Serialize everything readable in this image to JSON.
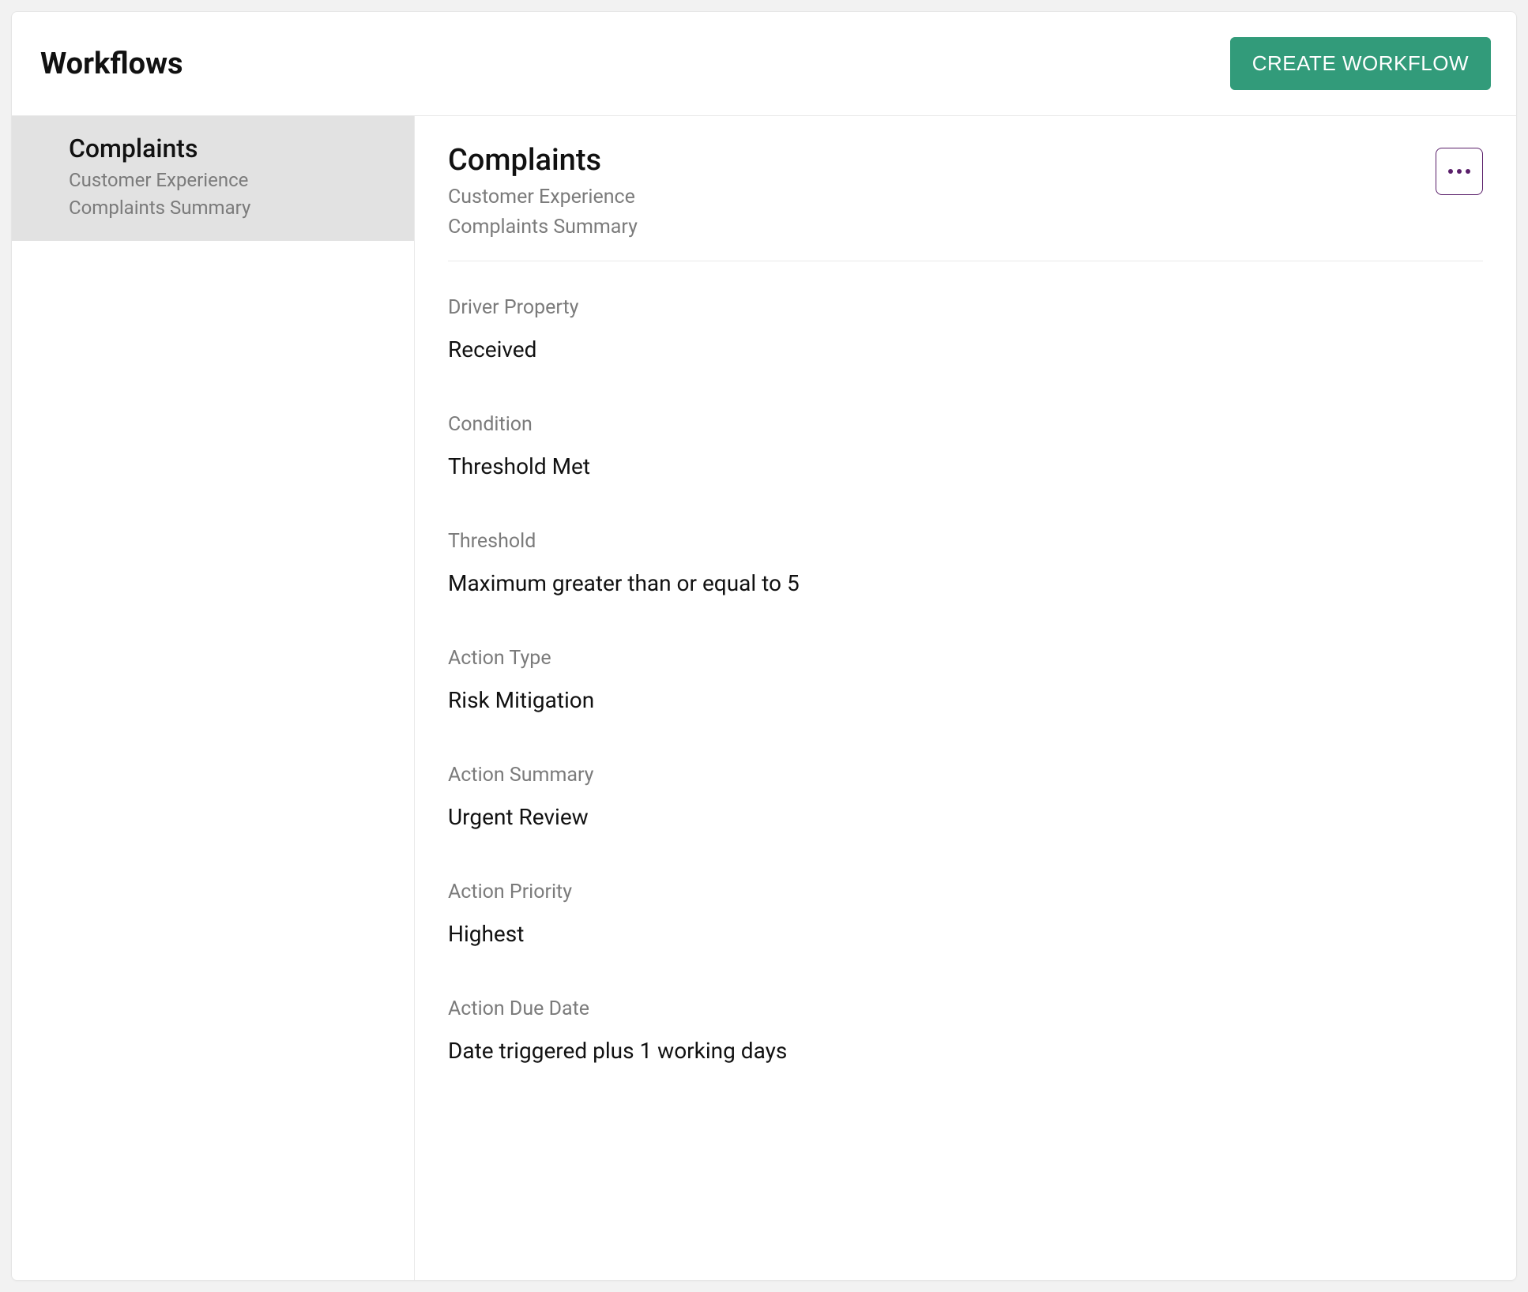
{
  "header": {
    "title": "Workflows",
    "create_button_label": "CREATE WORKFLOW"
  },
  "sidebar": {
    "items": [
      {
        "title": "Complaints",
        "subtitle1": "Customer Experience",
        "subtitle2": "Complaints Summary"
      }
    ]
  },
  "detail": {
    "title": "Complaints",
    "subtitle1": "Customer Experience",
    "subtitle2": "Complaints Summary",
    "fields": [
      {
        "label": "Driver Property",
        "value": "Received"
      },
      {
        "label": "Condition",
        "value": "Threshold Met"
      },
      {
        "label": "Threshold",
        "value": "Maximum greater than or equal to 5"
      },
      {
        "label": "Action Type",
        "value": "Risk Mitigation"
      },
      {
        "label": "Action Summary",
        "value": "Urgent Review"
      },
      {
        "label": "Action Priority",
        "value": "Highest"
      },
      {
        "label": "Action Due Date",
        "value": "Date triggered plus 1 working days"
      }
    ]
  }
}
